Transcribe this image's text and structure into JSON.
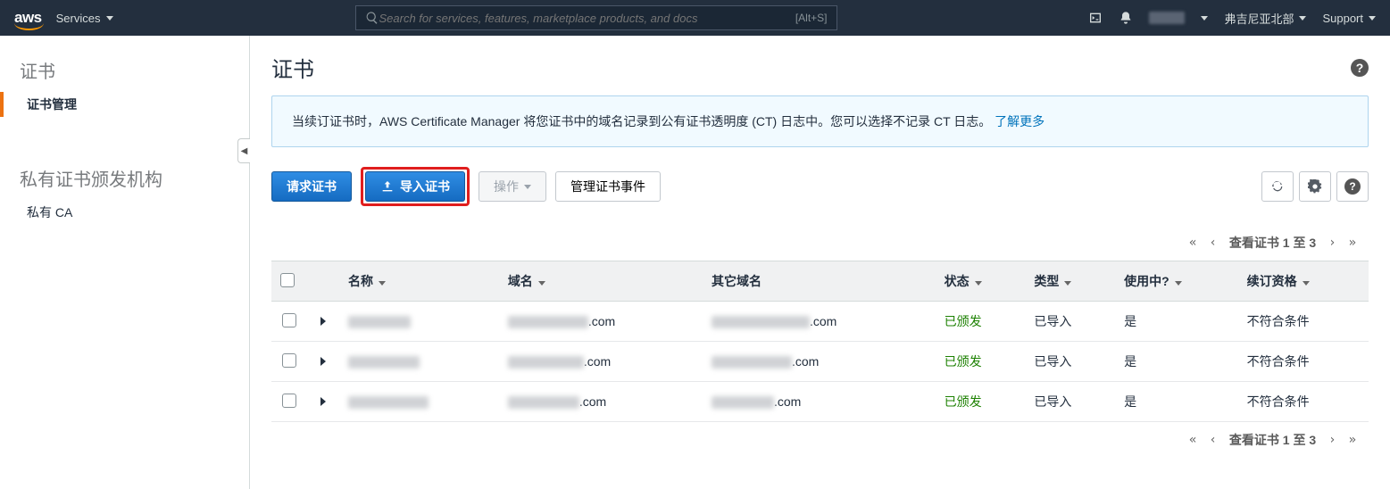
{
  "topnav": {
    "services_label": "Services",
    "search_placeholder": "Search for services, features, marketplace products, and docs",
    "search_shortcut": "[Alt+S]",
    "region_label": "弗吉尼亚北部",
    "support_label": "Support"
  },
  "sidebar": {
    "group_cert_title": "证书",
    "item_cert_mgmt": "证书管理",
    "group_pca_title": "私有证书颁发机构",
    "item_private_ca": "私有 CA"
  },
  "page": {
    "title": "证书"
  },
  "banner": {
    "text": "当续订证书时，AWS Certificate Manager 将您证书中的域名记录到公有证书透明度 (CT) 日志中。您可以选择不记录 CT 日志。",
    "link_label": "了解更多"
  },
  "actions": {
    "request_label": "请求证书",
    "import_label": "导入证书",
    "ops_label": "操作",
    "manage_events_label": "管理证书事件"
  },
  "pager": {
    "first": "«",
    "prev": "‹",
    "label": "查看证书 1 至 3",
    "next": "›",
    "last": "»"
  },
  "table": {
    "headers": {
      "name": "名称",
      "domain": "域名",
      "other_domains": "其它域名",
      "status": "状态",
      "type": "类型",
      "in_use": "使用中?",
      "renewal": "续订资格"
    },
    "rows": [
      {
        "name_suffix": "",
        "domain_suffix": ".com",
        "other_suffix": ".com",
        "status": "已颁发",
        "type": "已导入",
        "in_use": "是",
        "renewal": "不符合条件"
      },
      {
        "name_suffix": "",
        "domain_suffix": ".com",
        "other_suffix": ".com",
        "status": "已颁发",
        "type": "已导入",
        "in_use": "是",
        "renewal": "不符合条件"
      },
      {
        "name_suffix": "",
        "domain_suffix": ".com",
        "other_suffix": ".com",
        "status": "已颁发",
        "type": "已导入",
        "in_use": "是",
        "renewal": "不符合条件"
      }
    ]
  }
}
